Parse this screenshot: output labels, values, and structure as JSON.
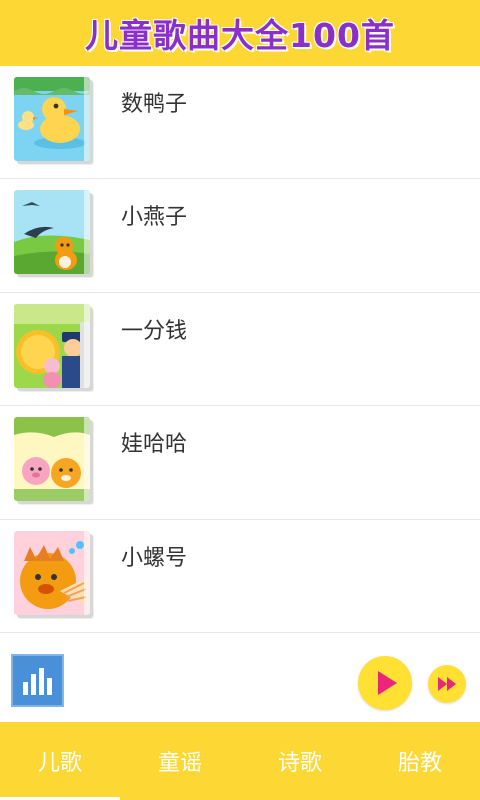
{
  "header": {
    "title": "儿童歌曲大全100首"
  },
  "songs": [
    {
      "title": "数鸭子",
      "icon": "duck-cover"
    },
    {
      "title": "小燕子",
      "icon": "swallow-cover"
    },
    {
      "title": "一分钱",
      "icon": "coin-police-cover"
    },
    {
      "title": "娃哈哈",
      "icon": "kids-cover"
    },
    {
      "title": "小螺号",
      "icon": "conch-cover"
    }
  ],
  "player": {
    "equalizer_icon": "equalizer-icon",
    "play_icon": "play-icon",
    "next_icon": "fast-forward-icon"
  },
  "tabs": [
    {
      "label": "儿歌"
    },
    {
      "label": "童谣"
    },
    {
      "label": "诗歌"
    },
    {
      "label": "胎教"
    }
  ],
  "colors": {
    "accent": "#fdd835",
    "title_purple": "#8b2fc9",
    "play_pink": "#e9267a"
  }
}
